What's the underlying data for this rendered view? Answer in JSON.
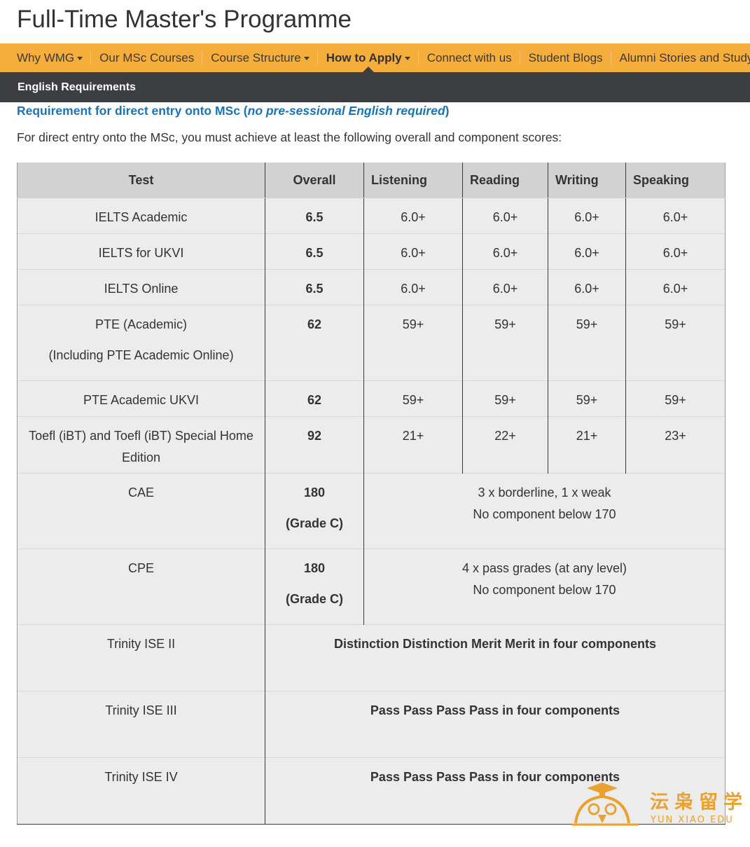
{
  "page": {
    "title": "Full-Time Master's Programme"
  },
  "nav": {
    "items": [
      {
        "label": "Why WMG",
        "dropdown": true
      },
      {
        "label": "Our MSc Courses",
        "dropdown": false
      },
      {
        "label": "Course Structure",
        "dropdown": true
      },
      {
        "label": "How to Apply",
        "dropdown": true,
        "active": true
      },
      {
        "label": "Connect with us",
        "dropdown": false
      },
      {
        "label": "Student Blogs",
        "dropdown": false
      },
      {
        "label": "Alumni Stories and Study In",
        "dropdown": false
      }
    ]
  },
  "subnav": {
    "active_label": "English Requirements"
  },
  "content": {
    "heading_prefix": "Requirement for direct entry onto MSc (",
    "heading_em": "no pre-sessional English required",
    "heading_suffix": ")",
    "intro": "For direct entry onto the MSc, you must achieve at least the following overall and component scores:"
  },
  "table": {
    "headers": [
      "Test",
      "Overall",
      "Listening",
      "Reading",
      "Writing",
      "Speaking"
    ],
    "rows": [
      {
        "test": "IELTS Academic",
        "overall": "6.5",
        "listening": "6.0+",
        "reading": "6.0+",
        "writing": "6.0+",
        "speaking": "6.0+"
      },
      {
        "test": "IELTS for UKVI",
        "overall": "6.5",
        "listening": "6.0+",
        "reading": "6.0+",
        "writing": "6.0+",
        "speaking": "6.0+"
      },
      {
        "test": "IELTS Online",
        "overall": "6.5",
        "listening": "6.0+",
        "reading": "6.0+",
        "writing": "6.0+",
        "speaking": "6.0+"
      },
      {
        "test": "PTE (Academic)",
        "test_note": "(Including PTE Academic Online)",
        "overall": "62",
        "listening": "59+",
        "reading": "59+",
        "writing": "59+",
        "speaking": "59+"
      },
      {
        "test": "PTE Academic UKVI",
        "overall": "62",
        "listening": "59+",
        "reading": "59+",
        "writing": "59+",
        "speaking": "59+"
      },
      {
        "test": "Toefl (iBT) and Toefl (iBT) Special Home Edition",
        "overall": "92",
        "listening": "21+",
        "reading": "22+",
        "writing": "21+",
        "speaking": "23+"
      },
      {
        "test": "CAE",
        "overall": "180",
        "overall_note": "(Grade C)",
        "components_line1": "3 x borderline, 1 x weak",
        "components_line2": "No component below 170"
      },
      {
        "test": "CPE",
        "overall": "180",
        "overall_note": "(Grade C)",
        "components_line1": "4 x pass grades (at any level)",
        "components_line2": "No component below 170"
      },
      {
        "test": "Trinity ISE II",
        "combined": "Distinction Distinction Merit Merit in four components"
      },
      {
        "test": "Trinity ISE III",
        "combined": "Pass Pass Pass Pass in four components"
      },
      {
        "test": "Trinity ISE IV",
        "combined": "Pass Pass Pass Pass in four components"
      }
    ]
  },
  "watermark": {
    "cn": "沄枭留学",
    "en": "YUN XIAO EDU"
  },
  "colors": {
    "nav_bg": "#f5ad3c",
    "subnav_bg": "#3c3e41",
    "heading_blue": "#1a73b5",
    "table_bg": "#ececec",
    "table_header_bg": "#d2d2d2",
    "watermark": "#e9a12f"
  }
}
